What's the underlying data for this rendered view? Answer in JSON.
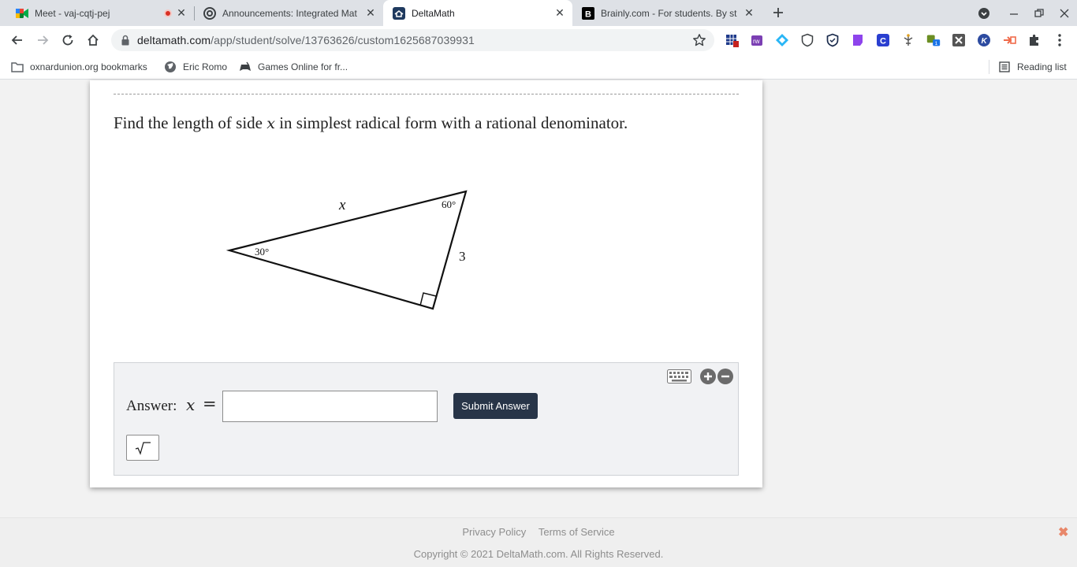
{
  "browser": {
    "tabs": [
      {
        "title": "Meet - vaj-cqtj-pej",
        "icon": "google-meet-icon",
        "recording": true
      },
      {
        "title": "Announcements: Integrated Mat",
        "icon": "canvas-icon"
      },
      {
        "title": "DeltaMath",
        "icon": "deltamath-icon",
        "active": true
      },
      {
        "title": "Brainly.com - For students. By st",
        "icon": "brainly-icon"
      }
    ],
    "url_host": "deltamath.com",
    "url_path": "/app/student/solve/13763626/custom1625687039931",
    "bookmarks": [
      {
        "label": "oxnardunion.org bookmarks",
        "icon": "folder-icon"
      },
      {
        "label": "Eric Romo",
        "icon": "globe-icon"
      },
      {
        "label": "Games Online for fr...",
        "icon": "gamepad-icon"
      }
    ],
    "reading_list": "Reading list",
    "extension_badge": "1"
  },
  "problem": {
    "prefix": "Find the length of side ",
    "variable": "x",
    "suffix": " in simplest radical form with a rational denominator.",
    "figure": {
      "hyp_label": "x",
      "leg_label": "3",
      "angle_top": "60°",
      "angle_left": "30°"
    }
  },
  "answer": {
    "label": "Answer:",
    "variable": "x",
    "equals": "=",
    "input_value": "",
    "submit_label": "Submit Answer",
    "sqrt_label": "√‾"
  },
  "footer": {
    "privacy": "Privacy Policy",
    "terms": "Terms of Service",
    "copyright": "Copyright © 2021 DeltaMath.com. All Rights Reserved."
  }
}
